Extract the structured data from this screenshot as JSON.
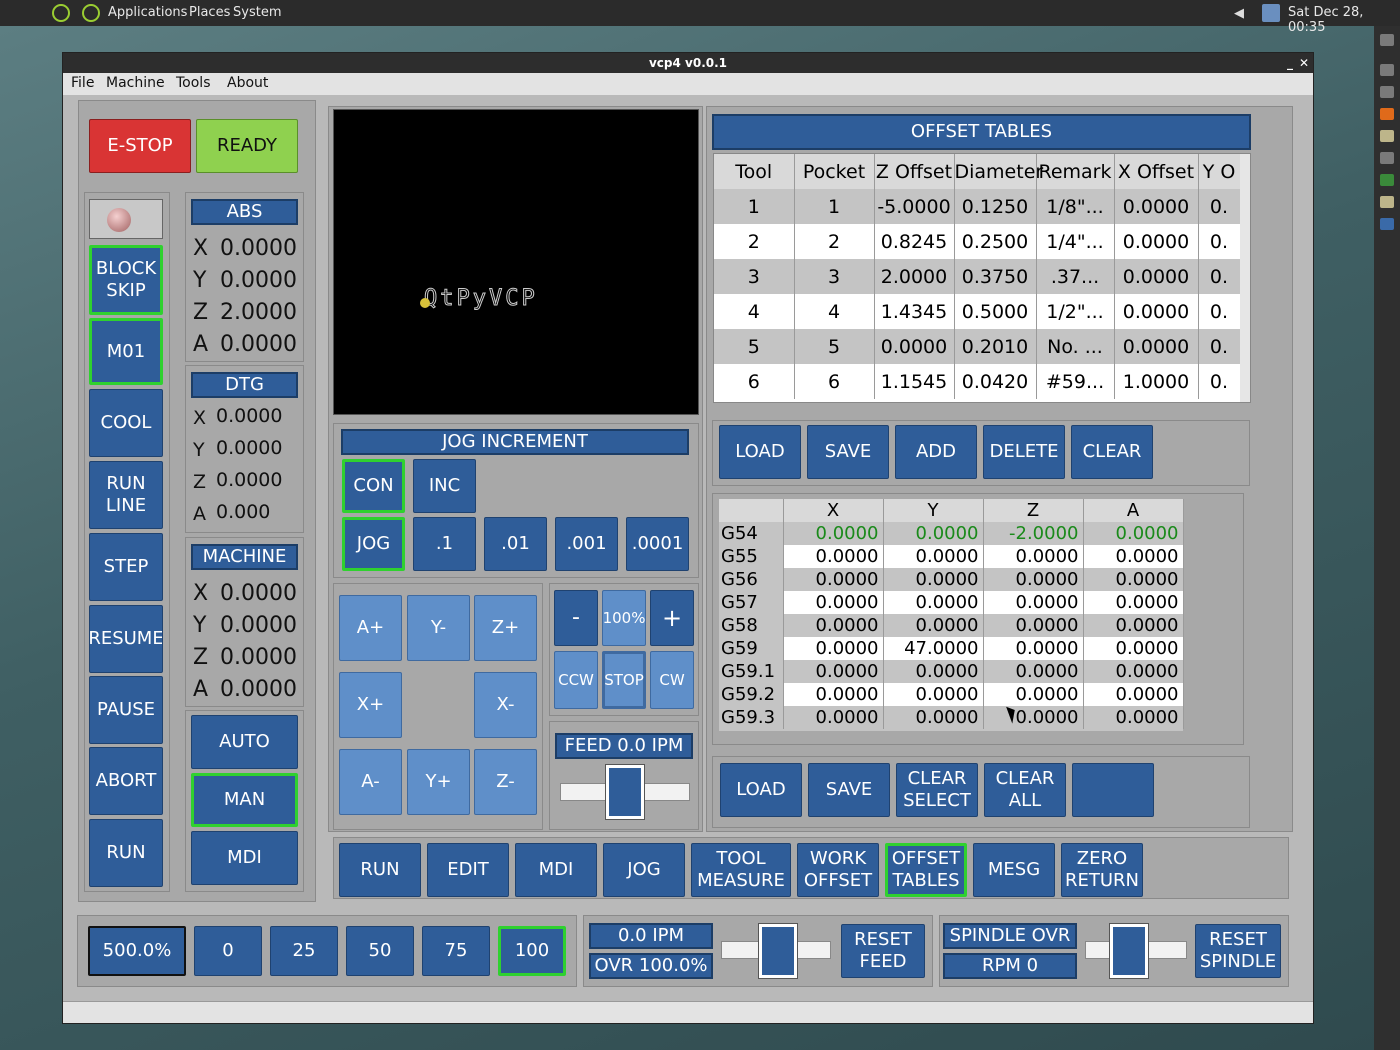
{
  "taskbar": {
    "menus": [
      "Applications",
      "Places",
      "System"
    ],
    "clock": "Sat Dec 28, 00:35"
  },
  "window": {
    "title": "vcp4 v0.0.1"
  },
  "menu": [
    "File",
    "Machine",
    "Tools",
    "About"
  ],
  "machine_state": {
    "estop_label": "E-STOP",
    "ready_label": "READY"
  },
  "left_buttons": [
    "BLOCK\nSKIP",
    "M01",
    "COOL",
    "RUN\nLINE",
    "STEP",
    "RESUME",
    "PAUSE",
    "ABORT",
    "RUN"
  ],
  "dro": {
    "abs_header": "ABS",
    "abs": [
      [
        "X",
        "0.0000"
      ],
      [
        "Y",
        "0.0000"
      ],
      [
        "Z",
        "2.0000"
      ],
      [
        "A",
        "0.0000"
      ]
    ],
    "dtg_header": "DTG",
    "dtg": [
      [
        "X",
        "0.0000"
      ],
      [
        "Y",
        "0.0000"
      ],
      [
        "Z",
        "0.0000"
      ],
      [
        "A",
        "0.000"
      ]
    ],
    "machine_header": "MACHINE",
    "machine": [
      [
        "X",
        "0.0000"
      ],
      [
        "Y",
        "0.0000"
      ],
      [
        "Z",
        "0.0000"
      ],
      [
        "A",
        "0.0000"
      ]
    ]
  },
  "modes": [
    "AUTO",
    "MAN",
    "MDI"
  ],
  "preview": {
    "logo_text": "QtPyVCP"
  },
  "jog": {
    "header": "JOG INCREMENT",
    "con": "CON",
    "inc": "INC",
    "jog": "JOG",
    "increments": [
      ".1",
      ".01",
      ".001",
      ".0001"
    ],
    "axis_buttons": [
      "A+",
      "Y-",
      "Z+",
      "X+",
      "X-",
      "A-",
      "Y+",
      "Z-"
    ]
  },
  "spindle_ctrl": {
    "minus": "-",
    "pct": "100%",
    "plus": "+",
    "ccw": "CCW",
    "stop": "STOP",
    "cw": "CW"
  },
  "feed": {
    "label": "FEED 0.0  IPM",
    "slider_value": 0.5
  },
  "offset_tables": {
    "header": "OFFSET TABLES",
    "tool_columns": [
      "Tool",
      "Pocket",
      "Z Offset",
      "Diameter",
      "Remark",
      "X Offset",
      "Y O"
    ],
    "tools": [
      [
        "1",
        "1",
        "-5.0000",
        "0.1250",
        "1/8\"...",
        "0.0000",
        "0."
      ],
      [
        "2",
        "2",
        "0.8245",
        "0.2500",
        "1/4\"...",
        "0.0000",
        "0."
      ],
      [
        "3",
        "3",
        "2.0000",
        "0.3750",
        ".37...",
        "0.0000",
        "0."
      ],
      [
        "4",
        "4",
        "1.4345",
        "0.5000",
        "1/2\"...",
        "0.0000",
        "0."
      ],
      [
        "5",
        "5",
        "0.0000",
        "0.2010",
        "No. ...",
        "0.0000",
        "0."
      ],
      [
        "6",
        "6",
        "1.1545",
        "0.0420",
        "#59...",
        "1.0000",
        "0."
      ]
    ],
    "tool_buttons": [
      "LOAD",
      "SAVE",
      "ADD",
      "DELETE",
      "CLEAR"
    ],
    "offset_columns": [
      "X",
      "Y",
      "Z",
      "A"
    ],
    "offsets": [
      [
        "G54",
        "0.0000",
        "0.0000",
        "-2.0000",
        "0.0000"
      ],
      [
        "G55",
        "0.0000",
        "0.0000",
        "0.0000",
        "0.0000"
      ],
      [
        "G56",
        "0.0000",
        "0.0000",
        "0.0000",
        "0.0000"
      ],
      [
        "G57",
        "0.0000",
        "0.0000",
        "0.0000",
        "0.0000"
      ],
      [
        "G58",
        "0.0000",
        "0.0000",
        "0.0000",
        "0.0000"
      ],
      [
        "G59",
        "0.0000",
        "47.0000",
        "0.0000",
        "0.0000"
      ],
      [
        "G59.1",
        "0.0000",
        "0.0000",
        "0.0000",
        "0.0000"
      ],
      [
        "G59.2",
        "0.0000",
        "0.0000",
        "0.0000",
        "0.0000"
      ],
      [
        "G59.3",
        "0.0000",
        "0.0000",
        "0.0000",
        "0.0000"
      ]
    ],
    "offset_buttons": [
      "LOAD",
      "SAVE",
      "CLEAR\nSELECT",
      "CLEAR\nALL",
      ""
    ]
  },
  "tabs": [
    "RUN",
    "EDIT",
    "MDI",
    "JOG",
    "TOOL\nMEASURE",
    "WORK\nOFFSET",
    "OFFSET\nTABLES",
    "MESG",
    "ZERO\nRETURN"
  ],
  "bottom": {
    "rapid_display": "500.0%",
    "rapid_presets": [
      "0",
      "25",
      "50",
      "75",
      "100"
    ],
    "feed_ipm": "0.0  IPM",
    "feed_ovr": "OVR 100.0%",
    "reset_feed": "RESET\nFEED",
    "spindle_ovr": "SPINDLE OVR",
    "spindle_rpm": "RPM 0",
    "reset_spindle": "RESET\nSPINDLE"
  },
  "colors": {
    "accent": "#2f5d99",
    "active_border": "#2fd12f",
    "estop": "#d93434",
    "ready": "#8fd14f",
    "g54_text": "#1a8a1a"
  }
}
